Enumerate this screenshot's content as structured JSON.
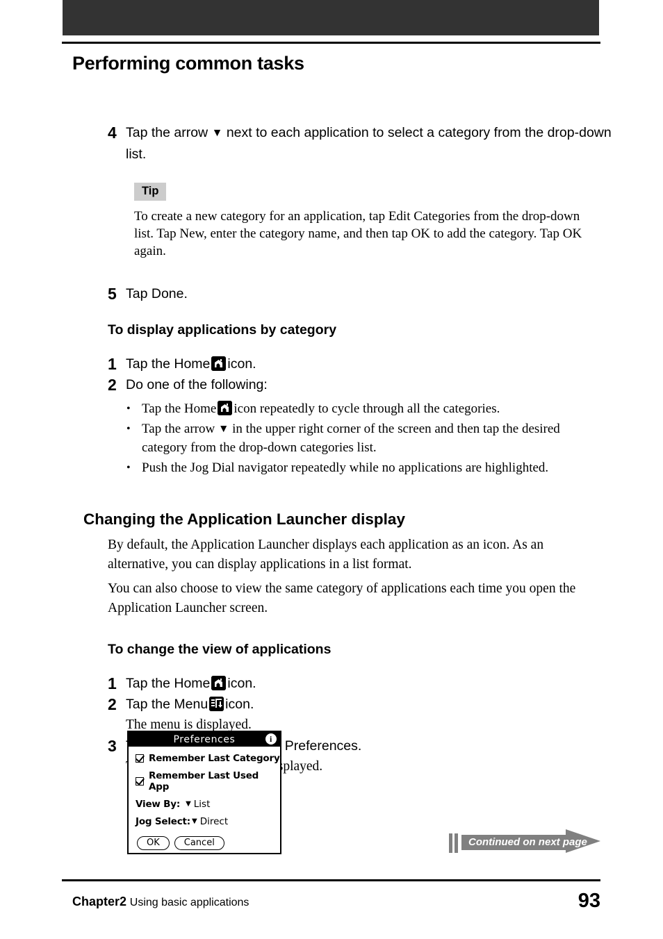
{
  "header": {
    "bar_color": "#333333"
  },
  "page_title": "Performing common tasks",
  "steps_group_1": {
    "step4": {
      "number": "4",
      "text_before": "Tap the arrow",
      "arrow": "▼",
      "text_after": "next to each application to select a category from the drop-down list."
    },
    "tip": {
      "label": "Tip",
      "text": "To create a new category for an application, tap Edit Categories from the drop-down list. Tap New, enter the category name, and then tap OK to add the category. Tap OK again."
    },
    "step5": {
      "number": "5",
      "text": "Tap Done."
    }
  },
  "display_by_category": {
    "heading": "To display applications by category",
    "step1": {
      "number": "1",
      "text_before": "Tap the Home",
      "icon": "home-icon",
      "text_after": "icon."
    },
    "step2": {
      "number": "2",
      "text": "Do one of the following:"
    },
    "bullets": [
      {
        "dot": "•",
        "text_before": "Tap the Home",
        "icon": "home-icon",
        "text_after": "icon repeatedly to cycle through all the categories."
      },
      {
        "dot": "•",
        "text_before": "Tap the arrow",
        "icon": "▼",
        "text_after": "in the upper right corner of the screen and then tap the desired category from the drop-down categories list."
      },
      {
        "dot": "•",
        "text_before": "Push the Jog Dial navigator repeatedly while no applications are highlighted.",
        "icon": "",
        "text_after": ""
      }
    ]
  },
  "launcher_section": {
    "heading": "Changing the Application Launcher display",
    "paragraph1": "By default, the Application Launcher displays each application as an icon. As an alternative, you can display applications in a list format.",
    "paragraph2": "You can also choose to view the same category of applications each time you open the Application Launcher screen."
  },
  "change_view": {
    "heading": "To change the view of applications",
    "step1": {
      "number": "1",
      "text_before": "Tap the Home",
      "icon": "home-icon",
      "text_after": "icon."
    },
    "step2": {
      "number": "2",
      "text_before": "Tap the Menu",
      "icon": "menu-icon",
      "text_after": "icon."
    },
    "step2_sub": "The menu is displayed.",
    "step3": {
      "number": "3",
      "text": "Tap Options, and then tap Preferences."
    },
    "step3_sub": "The Preferences screen is displayed."
  },
  "preferences_screen": {
    "title": "Preferences",
    "info_icon": "info-icon",
    "checkbox1": {
      "label": "Remember Last Category",
      "checked": true
    },
    "checkbox2": {
      "label": "Remember Last Used App",
      "checked": true
    },
    "view_by": {
      "label": "View By:",
      "arrow": "▼",
      "value": "List"
    },
    "jog_select": {
      "label": "Jog Select:",
      "arrow": "▼",
      "value": "Direct"
    },
    "ok_button": "OK",
    "cancel_button": "Cancel"
  },
  "continued_banner": {
    "text": "Continued on next page",
    "color": "#808080"
  },
  "footer": {
    "chapter": "Chapter2",
    "chapter_subtitle": "Using basic applications",
    "page_number": "93"
  }
}
